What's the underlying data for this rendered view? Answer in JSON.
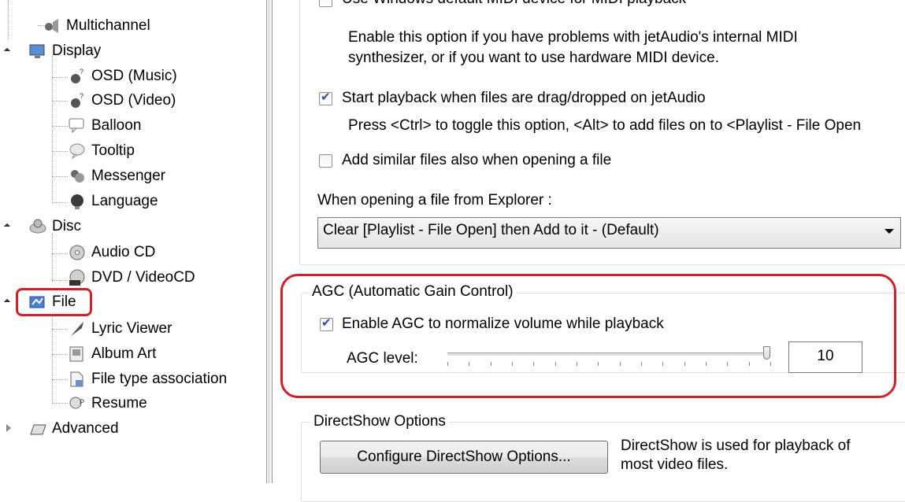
{
  "tree": {
    "items": [
      {
        "label": "Multichannel",
        "icon": "speaker-icon"
      },
      {
        "label": "Display",
        "icon": "monitor-icon"
      },
      {
        "label": "OSD (Music)",
        "icon": "osd-icon"
      },
      {
        "label": "OSD (Video)",
        "icon": "osd-icon"
      },
      {
        "label": "Balloon",
        "icon": "balloon-icon"
      },
      {
        "label": "Tooltip",
        "icon": "tooltip-icon"
      },
      {
        "label": "Messenger",
        "icon": "messenger-icon"
      },
      {
        "label": "Language",
        "icon": "globe-icon"
      },
      {
        "label": "Disc",
        "icon": "disc-icon"
      },
      {
        "label": "Audio CD",
        "icon": "cd-icon"
      },
      {
        "label": "DVD / VideoCD",
        "icon": "dvd-icon"
      },
      {
        "label": "File",
        "icon": "file-icon"
      },
      {
        "label": "Lyric Viewer",
        "icon": "lyric-icon"
      },
      {
        "label": "Album Art",
        "icon": "album-art-icon"
      },
      {
        "label": "File type association",
        "icon": "file-assoc-icon"
      },
      {
        "label": "Resume",
        "icon": "resume-icon"
      },
      {
        "label": "Advanced",
        "icon": "advanced-icon"
      }
    ]
  },
  "options": {
    "midi_label": "Use Windows default MIDI device for MIDI playback",
    "midi_desc_1": "Enable this option if you have problems with jetAudio's internal MIDI",
    "midi_desc_2": "synthesizer, or if you want to use hardware MIDI device.",
    "drag_label": "Start playback when files are drag/dropped on jetAudio",
    "drag_desc": "Press <Ctrl> to toggle this option, <Alt> to add files on to <Playlist - File Open",
    "similar_label": "Add similar files also when opening a file",
    "explorer_label": "When opening a file from Explorer :",
    "explorer_value": "Clear [Playlist - File Open] then Add to it - (Default)"
  },
  "agc": {
    "title": "AGC (Automatic Gain Control)",
    "enable_label": "Enable AGC to normalize volume while playback",
    "level_label": "AGC level:",
    "level_value": "10",
    "slider_fraction": 1.0
  },
  "directshow": {
    "title": "DirectShow Options",
    "button_label": "Configure DirectShow Options...",
    "desc_1": "DirectShow is used for playback of",
    "desc_2": "most video files."
  },
  "colors": {
    "highlight": "#d0202a",
    "check": "#2a4fa8"
  }
}
